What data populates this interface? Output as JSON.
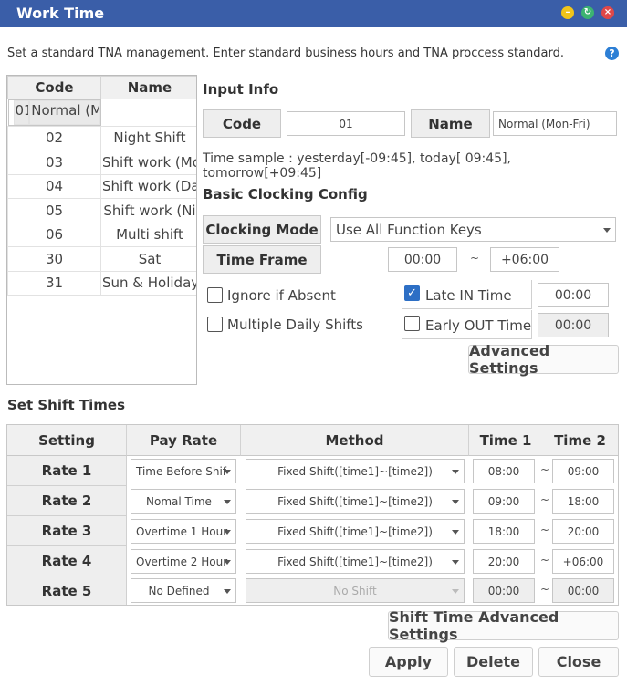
{
  "window": {
    "title": "Work Time",
    "controls": [
      "minimize-icon",
      "maximize-icon",
      "close-icon"
    ],
    "colors": {
      "titlebar": "#3a5ea8",
      "minimize": "#f0c419",
      "maximize": "#3cb371",
      "close": "#e04848"
    }
  },
  "description": "Set a standard TNA management. Enter standard business hours and TNA proccess standard.",
  "help_icon": "?",
  "shift_list": {
    "headers": {
      "code": "Code",
      "name": "Name"
    },
    "rows": [
      {
        "code": "01",
        "name": "Normal (Mon-"
      },
      {
        "code": "02",
        "name": "Night Shift"
      },
      {
        "code": "03",
        "name": "Shift work (Mo"
      },
      {
        "code": "04",
        "name": "Shift work (Da"
      },
      {
        "code": "05",
        "name": "Shift work (Ni"
      },
      {
        "code": "06",
        "name": "Multi shift"
      },
      {
        "code": "30",
        "name": "Sat"
      },
      {
        "code": "31",
        "name": "Sun & Holiday"
      }
    ]
  },
  "input_info": {
    "section": "Input Info",
    "code_label": "Code",
    "code_value": "01",
    "name_label": "Name",
    "name_value": "Normal (Mon-Fri)",
    "time_sample": "Time sample : yesterday[-09:45], today[ 09:45], tomorrow[+09:45]"
  },
  "clocking": {
    "section": "Basic Clocking Config",
    "mode_label": "Clocking Mode",
    "mode_value": "Use All Function Keys",
    "frame_label": "Time Frame",
    "frame_start": "00:00",
    "frame_sep": "~",
    "frame_end": "+06:00",
    "ignore_absent": {
      "label": "Ignore if Absent",
      "checked": false
    },
    "multiple_shifts": {
      "label": "Multiple Daily Shifts",
      "checked": false
    },
    "late_in": {
      "label": "Late IN Time",
      "checked": true,
      "value": "00:00"
    },
    "early_out": {
      "label": "Early OUT Time",
      "checked": false,
      "value": "00:00"
    },
    "advanced_button": "Advanced Settings"
  },
  "shift_times": {
    "section": "Set Shift Times",
    "headers": {
      "setting": "Setting",
      "pay_rate": "Pay Rate",
      "method": "Method",
      "time1": "Time 1",
      "time2": "Time 2"
    },
    "sep": "~",
    "rows": [
      {
        "label": "Rate 1",
        "pay_rate": "Time Before Shif",
        "method": "Fixed Shift([time1]~[time2])",
        "time1": "08:00",
        "time2": "09:00",
        "enabled": true
      },
      {
        "label": "Rate 2",
        "pay_rate": "Nomal Time",
        "method": "Fixed Shift([time1]~[time2])",
        "time1": "09:00",
        "time2": "18:00",
        "enabled": true
      },
      {
        "label": "Rate 3",
        "pay_rate": "Overtime 1 Hour",
        "method": "Fixed Shift([time1]~[time2])",
        "time1": "18:00",
        "time2": "20:00",
        "enabled": true
      },
      {
        "label": "Rate 4",
        "pay_rate": "Overtime 2 Hour",
        "method": "Fixed Shift([time1]~[time2])",
        "time1": "20:00",
        "time2": "+06:00",
        "enabled": true
      },
      {
        "label": "Rate 5",
        "pay_rate": "No Defined",
        "method": "No Shift",
        "time1": "00:00",
        "time2": "00:00",
        "enabled": false
      }
    ],
    "advanced_button": "Shift Time Advanced Settings"
  },
  "footer": {
    "apply": "Apply",
    "delete": "Delete",
    "close": "Close"
  }
}
